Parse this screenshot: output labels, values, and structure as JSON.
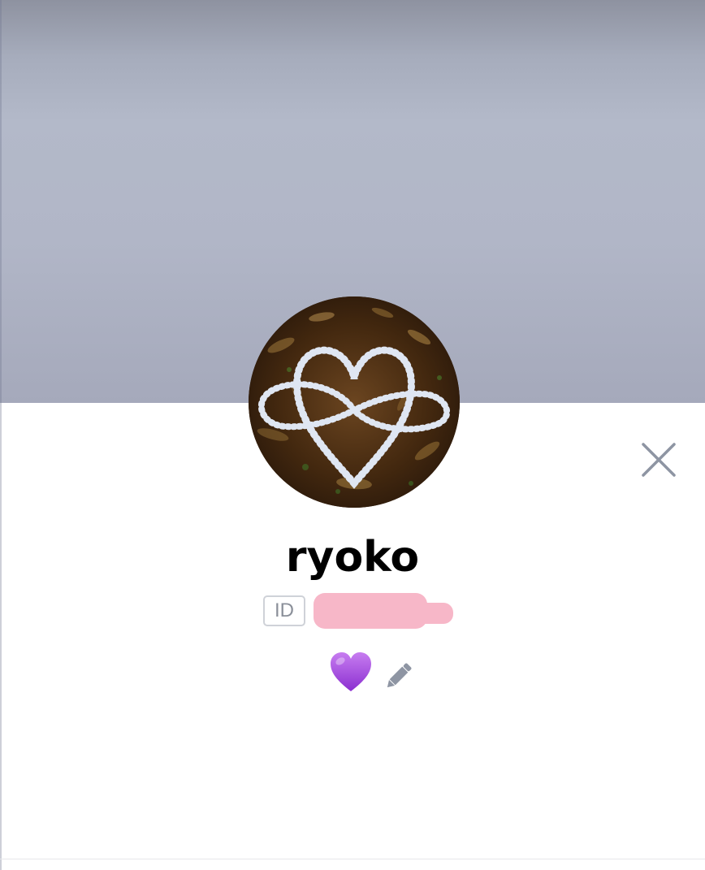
{
  "profile": {
    "name": "ryoko",
    "id_label": "ID",
    "status_emoji": "💜",
    "avatar_icon": "heart-infinity-photo"
  },
  "actions": {
    "close_icon": "close-icon",
    "edit_icon": "pencil-icon"
  },
  "colors": {
    "cover": "#b1b6c7",
    "name": "#000000",
    "id_badge_border": "#cfd2d8",
    "icon_gray": "#8e95a3",
    "redaction": "#f7b7c8"
  }
}
